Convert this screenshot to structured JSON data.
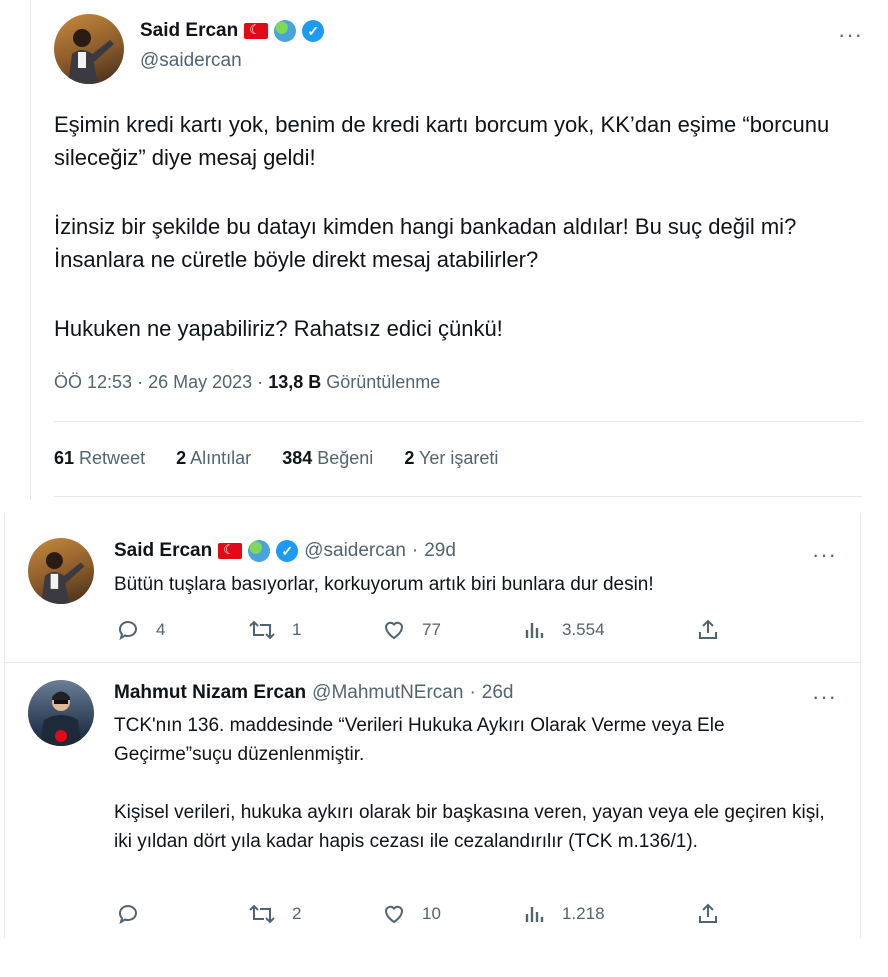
{
  "main_tweet": {
    "name": "Said Ercan",
    "handle": "@saidercan",
    "paragraphs": [
      "Eşimin kredi kartı yok, benim de kredi kartı borcum yok, KK’dan eşime “borcunu sileceğiz” diye mesaj geldi!",
      "İzinsiz bir şekilde bu datayı kimden hangi bankadan aldılar! Bu suç değil mi? İnsanlara ne cüretle böyle direkt mesaj atabilirler?",
      "Hukuken ne yapabiliriz? Rahatsız edici çünkü!"
    ],
    "time": "ÖÖ 12:53",
    "date": "26 May 2023",
    "views": "13,8 B",
    "views_label": "Görüntülenme",
    "stats": {
      "retweets": "61",
      "retweets_label": "Retweet",
      "quotes": "2",
      "quotes_label": "Alıntılar",
      "likes": "384",
      "likes_label": "Beğeni",
      "bookmarks": "2",
      "bookmarks_label": "Yer işareti"
    }
  },
  "replies": [
    {
      "name": "Said Ercan",
      "handle": "@saidercan",
      "age": "29d",
      "text": "Bütün tuşlara basıyorlar, korkuyorum artık biri bunlara dur desin!",
      "replies": "4",
      "retweets": "1",
      "likes": "77",
      "views": "3.554"
    },
    {
      "name": "Mahmut Nizam Ercan",
      "handle": "@MahmutNErcan",
      "age": "26d",
      "paragraphs": [
        "TCK'nın 136. maddesinde “Verileri Hukuka Aykırı Olarak Verme veya Ele Geçirme”suçu düzenlenmiştir.",
        "Kişisel verileri, hukuka aykırı olarak bir başkasına veren, yayan veya ele geçiren kişi, iki yıldan dört yıla kadar hapis cezası ile cezalandırılır (TCK m.136/1)."
      ],
      "replies": "",
      "retweets": "2",
      "likes": "10",
      "views": "1.218"
    }
  ],
  "icons": {
    "more": "more-icon",
    "reply": "reply-icon",
    "retweet": "retweet-icon",
    "like": "like-icon",
    "views": "views-icon",
    "share": "share-icon"
  },
  "sep": "·",
  "more_glyph": "···",
  "colors": {
    "accent": "#1d9bf0",
    "muted": "#536471",
    "text": "#0f1419"
  }
}
